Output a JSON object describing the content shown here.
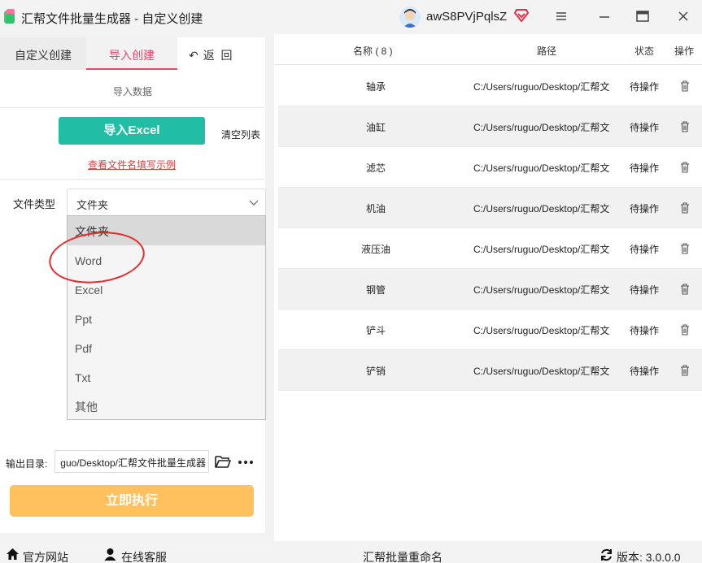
{
  "window": {
    "title": "汇帮文件批量生成器 - 自定义创建",
    "username": "awS8PVjPqlsZ"
  },
  "tabs": [
    {
      "label": "自定义创建"
    },
    {
      "label": "导入创建"
    },
    {
      "label": "返  回"
    }
  ],
  "import_section": {
    "title": "导入数据",
    "import_button": "导入Excel",
    "clear_list": "清空列表",
    "example_link": "查看文件名填写示例"
  },
  "file_type": {
    "label": "文件类型",
    "selected": "文件夹",
    "options": [
      "文件夹",
      "Word",
      "Excel",
      "Ppt",
      "Pdf",
      "Txt",
      "其他"
    ]
  },
  "output": {
    "label": "输出目录:",
    "value": "guo/Desktop/汇帮文件批量生成器"
  },
  "execute_button": "立即执行",
  "table": {
    "headers": {
      "name": "名称 ( 8 )",
      "path": "路径",
      "status": "状态",
      "action": "操作"
    },
    "rows": [
      {
        "name": "轴承",
        "path": "C:/Users/ruguo/Desktop/汇帮文",
        "status": "待操作"
      },
      {
        "name": "油缸",
        "path": "C:/Users/ruguo/Desktop/汇帮文",
        "status": "待操作"
      },
      {
        "name": "滤芯",
        "path": "C:/Users/ruguo/Desktop/汇帮文",
        "status": "待操作"
      },
      {
        "name": "机油",
        "path": "C:/Users/ruguo/Desktop/汇帮文",
        "status": "待操作"
      },
      {
        "name": "液压油",
        "path": "C:/Users/ruguo/Desktop/汇帮文",
        "status": "待操作"
      },
      {
        "name": "钢管",
        "path": "C:/Users/ruguo/Desktop/汇帮文",
        "status": "待操作"
      },
      {
        "name": "铲斗",
        "path": "C:/Users/ruguo/Desktop/汇帮文",
        "status": "待操作"
      },
      {
        "name": "铲销",
        "path": "C:/Users/ruguo/Desktop/汇帮文",
        "status": "待操作"
      }
    ]
  },
  "footer": {
    "website": "官方网站",
    "support": "在线客服",
    "product": "汇帮批量重命名",
    "version": "版本: 3.0.0.0"
  },
  "colors": {
    "accent_teal": "#22bda5",
    "accent_pink": "#e64a6b",
    "execute_orange": "#fec15d",
    "annotation_red": "#e52b2b"
  }
}
